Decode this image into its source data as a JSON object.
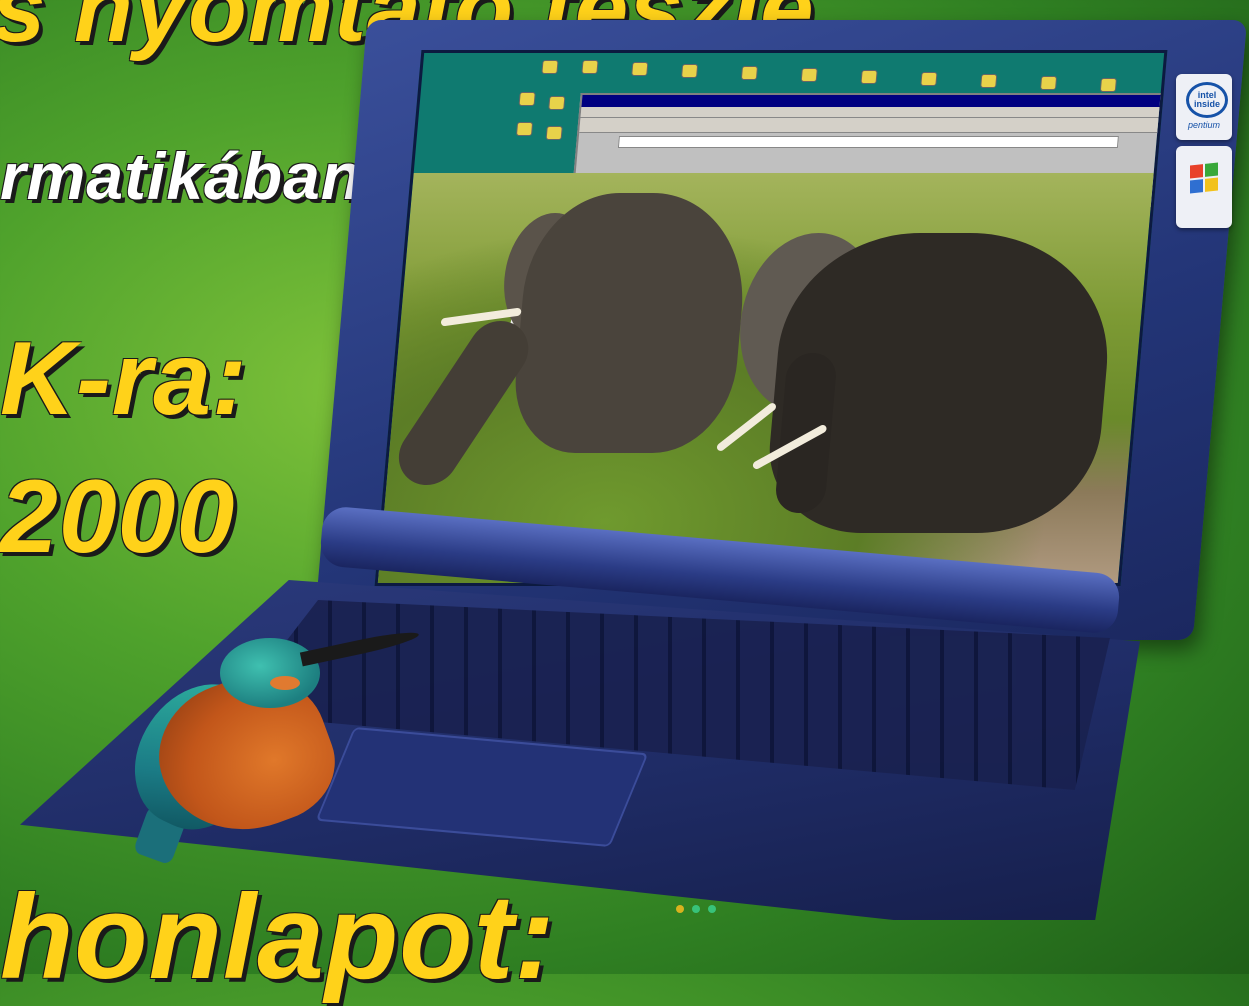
{
  "headlines": {
    "line1": "s nyomtató teszje",
    "line2": "rmatikában",
    "line3": "K-ra:",
    "line4": "2000",
    "line5": "honlapot:"
  },
  "badges": {
    "intel_inside": "intel inside",
    "intel_brand": "pentium"
  },
  "colors": {
    "headline": "#ffd21a",
    "subheadline": "#ffffff",
    "background": "#4fa22c",
    "laptop_body": "#233577"
  },
  "images": {
    "laptop": "laptop-icon",
    "screen_photo": "elephants-photo",
    "bird": "kingfisher-illustration",
    "intel_logo": "intel-logo-icon",
    "windows_logo": "windows-logo-icon"
  }
}
